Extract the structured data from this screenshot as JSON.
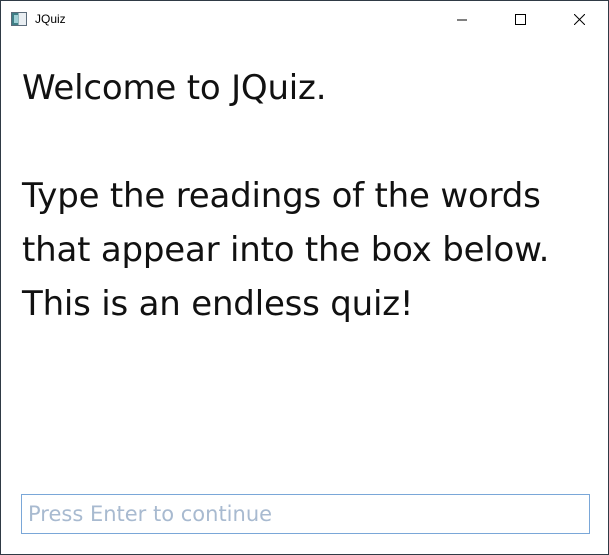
{
  "window": {
    "title": "JQuiz",
    "icon": "app-window-icon",
    "controls": {
      "minimize_icon": "minimize-icon",
      "maximize_icon": "maximize-icon",
      "close_icon": "close-icon"
    }
  },
  "main": {
    "welcome_line": "Welcome to JQuiz.",
    "instructions": [
      "Type the readings of the words",
      "that appear into the box below.",
      "This is an endless quiz!"
    ]
  },
  "answer_input": {
    "value": "",
    "placeholder": "Press Enter to continue",
    "border_color": "#7aa7d8"
  }
}
